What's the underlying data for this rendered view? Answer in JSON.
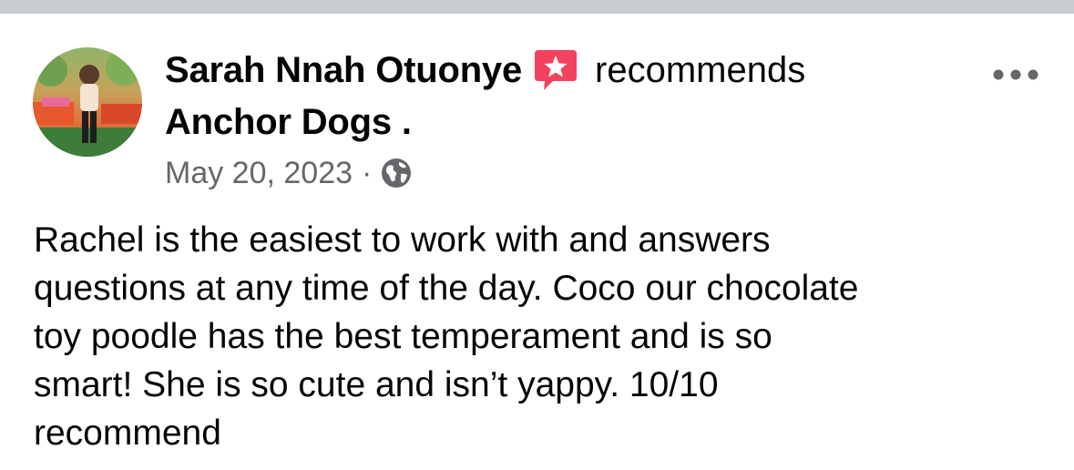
{
  "post": {
    "author_name": "Sarah Nnah Otuonye",
    "action_text": "recommends",
    "page_name": "Anchor Dogs .",
    "date": "May 20, 2023",
    "separator": "·",
    "privacy_icon": "globe-icon",
    "recommend_icon": "recommend-badge-icon",
    "more_icon": "more-options-icon",
    "body": "Rachel is the easiest to work with and answers\nquestions at any time of the day. Coco our chocolate\ntoy poodle has the best temperament and is so\nsmart! She is so cute and isn’t yappy. 10/10\nrecommend"
  },
  "colors": {
    "recommend_badge": "#f3425f",
    "secondary_text": "#65676b",
    "primary_text": "#050505",
    "top_bar": "#c9ccd1"
  }
}
